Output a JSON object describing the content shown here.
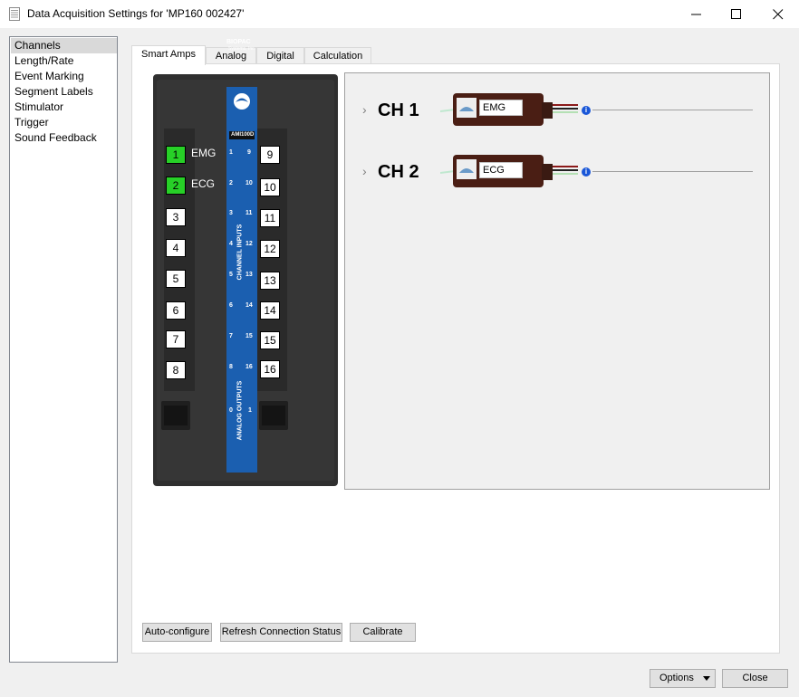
{
  "window": {
    "title": "Data Acquisition Settings for 'MP160 002427'",
    "minimize_icon": "minimize-icon",
    "maximize_icon": "maximize-icon",
    "close_icon": "close-icon"
  },
  "sidebar": {
    "items": [
      {
        "label": "Channels",
        "selected": true
      },
      {
        "label": "Length/Rate"
      },
      {
        "label": "Event Marking"
      },
      {
        "label": "Segment Labels"
      },
      {
        "label": "Stimulator"
      },
      {
        "label": "Trigger"
      },
      {
        "label": "Sound Feedback"
      }
    ]
  },
  "tabs": [
    {
      "label": "Smart Amps",
      "active": true
    },
    {
      "label": "Analog"
    },
    {
      "label": "Digital"
    },
    {
      "label": "Calculation"
    }
  ],
  "device": {
    "brand": "BIOPAC",
    "brand_sub": "Systems, Inc.",
    "model": "AMI100D",
    "channel_inputs_label": "CHANNEL INPUTS",
    "analog_outputs_label": "ANALOG OUTPUTS",
    "ports_left": [
      {
        "num": "1",
        "name": "EMG",
        "active": true
      },
      {
        "num": "2",
        "name": "ECG",
        "active": true
      },
      {
        "num": "3",
        "name": ""
      },
      {
        "num": "4",
        "name": ""
      },
      {
        "num": "5",
        "name": ""
      },
      {
        "num": "6",
        "name": ""
      },
      {
        "num": "7",
        "name": ""
      },
      {
        "num": "8",
        "name": ""
      }
    ],
    "ports_right": [
      "9",
      "10",
      "11",
      "12",
      "13",
      "14",
      "15",
      "16"
    ],
    "strip_left": [
      "1",
      "2",
      "3",
      "4",
      "5",
      "6",
      "7",
      "8"
    ],
    "strip_right": [
      "9",
      "10",
      "11",
      "12",
      "13",
      "14",
      "15",
      "16"
    ],
    "output_labels": [
      "0",
      "1"
    ]
  },
  "channels": [
    {
      "label": "CH 1",
      "amp": "EMG"
    },
    {
      "label": "CH 2",
      "amp": "ECG"
    }
  ],
  "buttons": {
    "auto_configure": "Auto-configure",
    "refresh": "Refresh Connection Status",
    "calibrate": "Calibrate",
    "options": "Options",
    "close": "Close"
  },
  "colors": {
    "active_port": "#27d027",
    "device_body": "#2e2e2e",
    "blue_strip": "#1b5fb0",
    "info_icon": "#1a57d8"
  }
}
